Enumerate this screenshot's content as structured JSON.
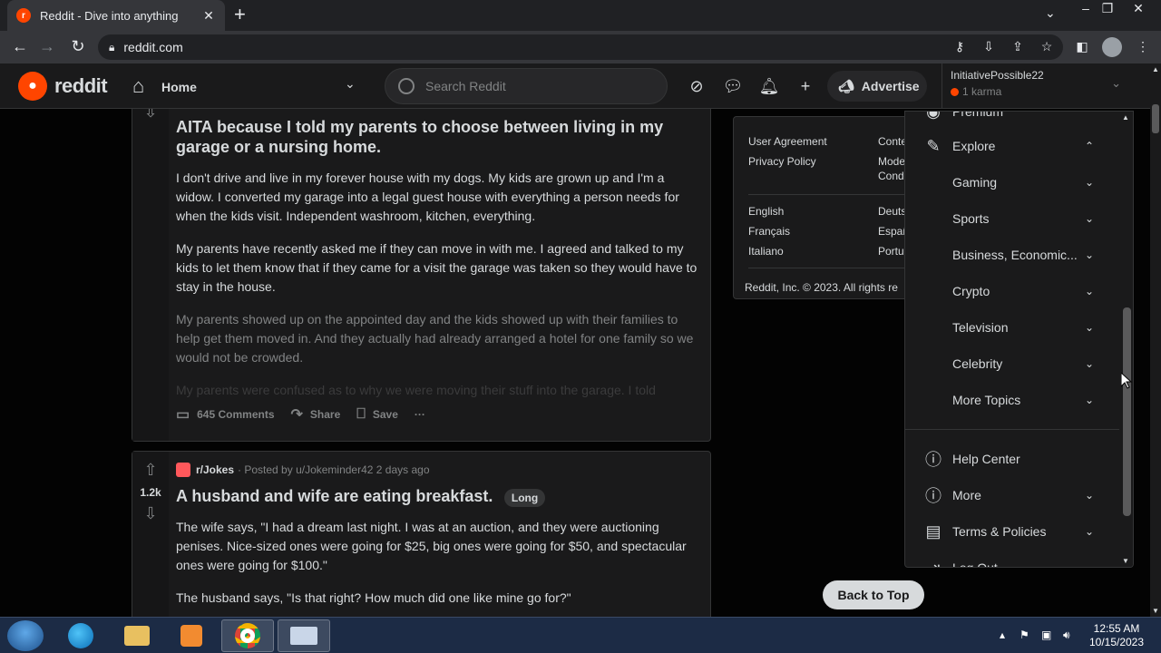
{
  "browser": {
    "tab_title": "Reddit - Dive into anything",
    "url": "reddit.com",
    "favicon_letter": "r"
  },
  "header": {
    "logo_text": "reddit",
    "home_label": "Home",
    "search_placeholder": "Search Reddit",
    "advertise_label": "Advertise",
    "username": "InitiativePossible22",
    "karma": "1 karma"
  },
  "post1": {
    "title": "AITA because I told my parents to choose between living in my garage or a nursing home.",
    "paragraphs": [
      "I don't drive and live in my forever house with my dogs. My kids are grown up and I'm a widow. I converted my garage into a legal guest house with everything a person needs for when the kids visit. Independent washroom, kitchen, everything.",
      "My parents have recently asked me if they can move in with me. I agreed and talked to my kids to let them know that if they came for a visit the garage was taken so they would have to stay in the house.",
      "My parents showed up on the appointed day and the kids showed up with their families to help get them moved in. And they actually had already arranged a hotel for one family so we would not be crowded.",
      "My parents were confused as to why we were moving their stuff into the garage. I told"
    ],
    "comments": "645 Comments",
    "share": "Share",
    "save": "Save",
    "more": "···"
  },
  "post2": {
    "votes": "1.2k",
    "subreddit": "r/Jokes",
    "posted_by": "· Posted by u/Jokeminder42 2 days ago",
    "title": "A husband and wife are eating breakfast.",
    "flair": "Long",
    "paragraphs": [
      "The wife says, \"I had a dream last night. I was at an auction, and they were auctioning penises. Nice-sized ones were going for $25, big ones were going for $50, and spectacular ones were going for $100.\"",
      "The husband says, \"Is that right? How much did one like mine go for?\""
    ]
  },
  "sidebar": {
    "links_left": [
      "User Agreement",
      "Privacy Policy"
    ],
    "links_right": [
      "Conte",
      "Mode",
      "Cond"
    ],
    "langs_left": [
      "English",
      "Français",
      "Italiano"
    ],
    "langs_right": [
      "Deuts",
      "Españ",
      "Portu"
    ],
    "copyright": "Reddit, Inc. © 2023. All rights re"
  },
  "menu": {
    "premium": "Premium",
    "explore": "Explore",
    "topics": [
      "Gaming",
      "Sports",
      "Business, Economic...",
      "Crypto",
      "Television",
      "Celebrity",
      "More Topics"
    ],
    "help_center": "Help Center",
    "more": "More",
    "terms": "Terms & Policies",
    "logout": "Log Out"
  },
  "back_to_top": "Back to Top",
  "taskbar": {
    "time": "12:55 AM",
    "date": "10/15/2023"
  },
  "colors": {
    "reddit_orange": "#ff4500",
    "bg": "#030303",
    "card": "#1a1a1b",
    "border": "#343536",
    "text": "#d7dadc",
    "muted": "#818384"
  }
}
